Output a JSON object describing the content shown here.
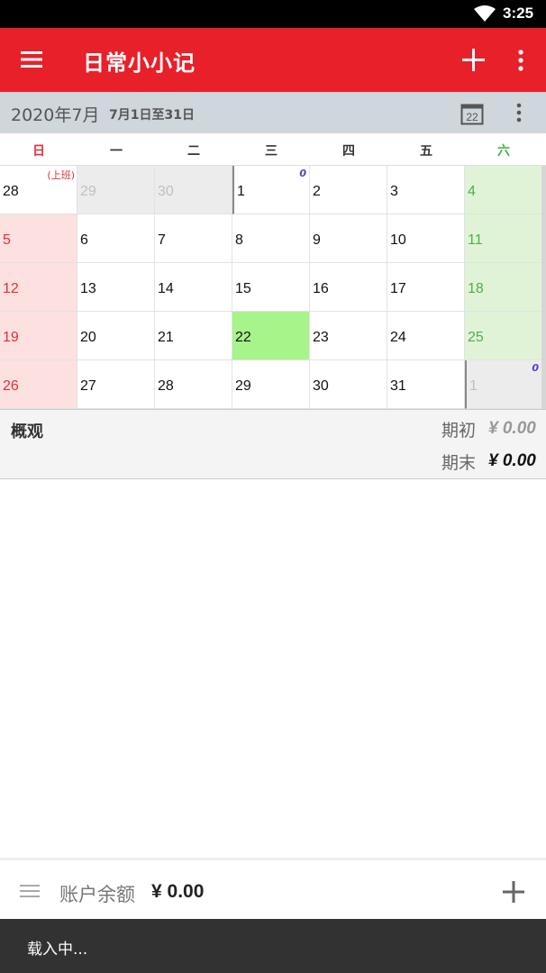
{
  "status": {
    "time": "3:25"
  },
  "appbar": {
    "title": "日常小小记"
  },
  "subbar": {
    "month": "2020年7月",
    "range": "7月1日至31日",
    "today_day": "22"
  },
  "weekdays": [
    "日",
    "一",
    "二",
    "三",
    "四",
    "五",
    "六"
  ],
  "calendar": {
    "workday_tag": "(上班)",
    "zero_label": "0",
    "weeks": [
      [
        "28",
        "29",
        "30",
        "1",
        "2",
        "3",
        "4"
      ],
      [
        "5",
        "6",
        "7",
        "8",
        "9",
        "10",
        "11"
      ],
      [
        "12",
        "13",
        "14",
        "15",
        "16",
        "17",
        "18"
      ],
      [
        "19",
        "20",
        "21",
        "22",
        "23",
        "24",
        "25"
      ],
      [
        "26",
        "27",
        "28",
        "29",
        "30",
        "31",
        "1"
      ]
    ],
    "today": "22"
  },
  "summary": {
    "title": "概观",
    "start_label": "期初",
    "start_value": "¥ 0.00",
    "end_label": "期末",
    "end_value": "¥ 0.00"
  },
  "bottom": {
    "balance_label": "账户余额",
    "balance_value": "¥ 0.00"
  },
  "toast": {
    "text": "载入中..."
  },
  "colors": {
    "primary": "#e8202a",
    "sunday": "#e0303a",
    "saturday": "#4caf50",
    "today_bg": "#a6f48a"
  }
}
